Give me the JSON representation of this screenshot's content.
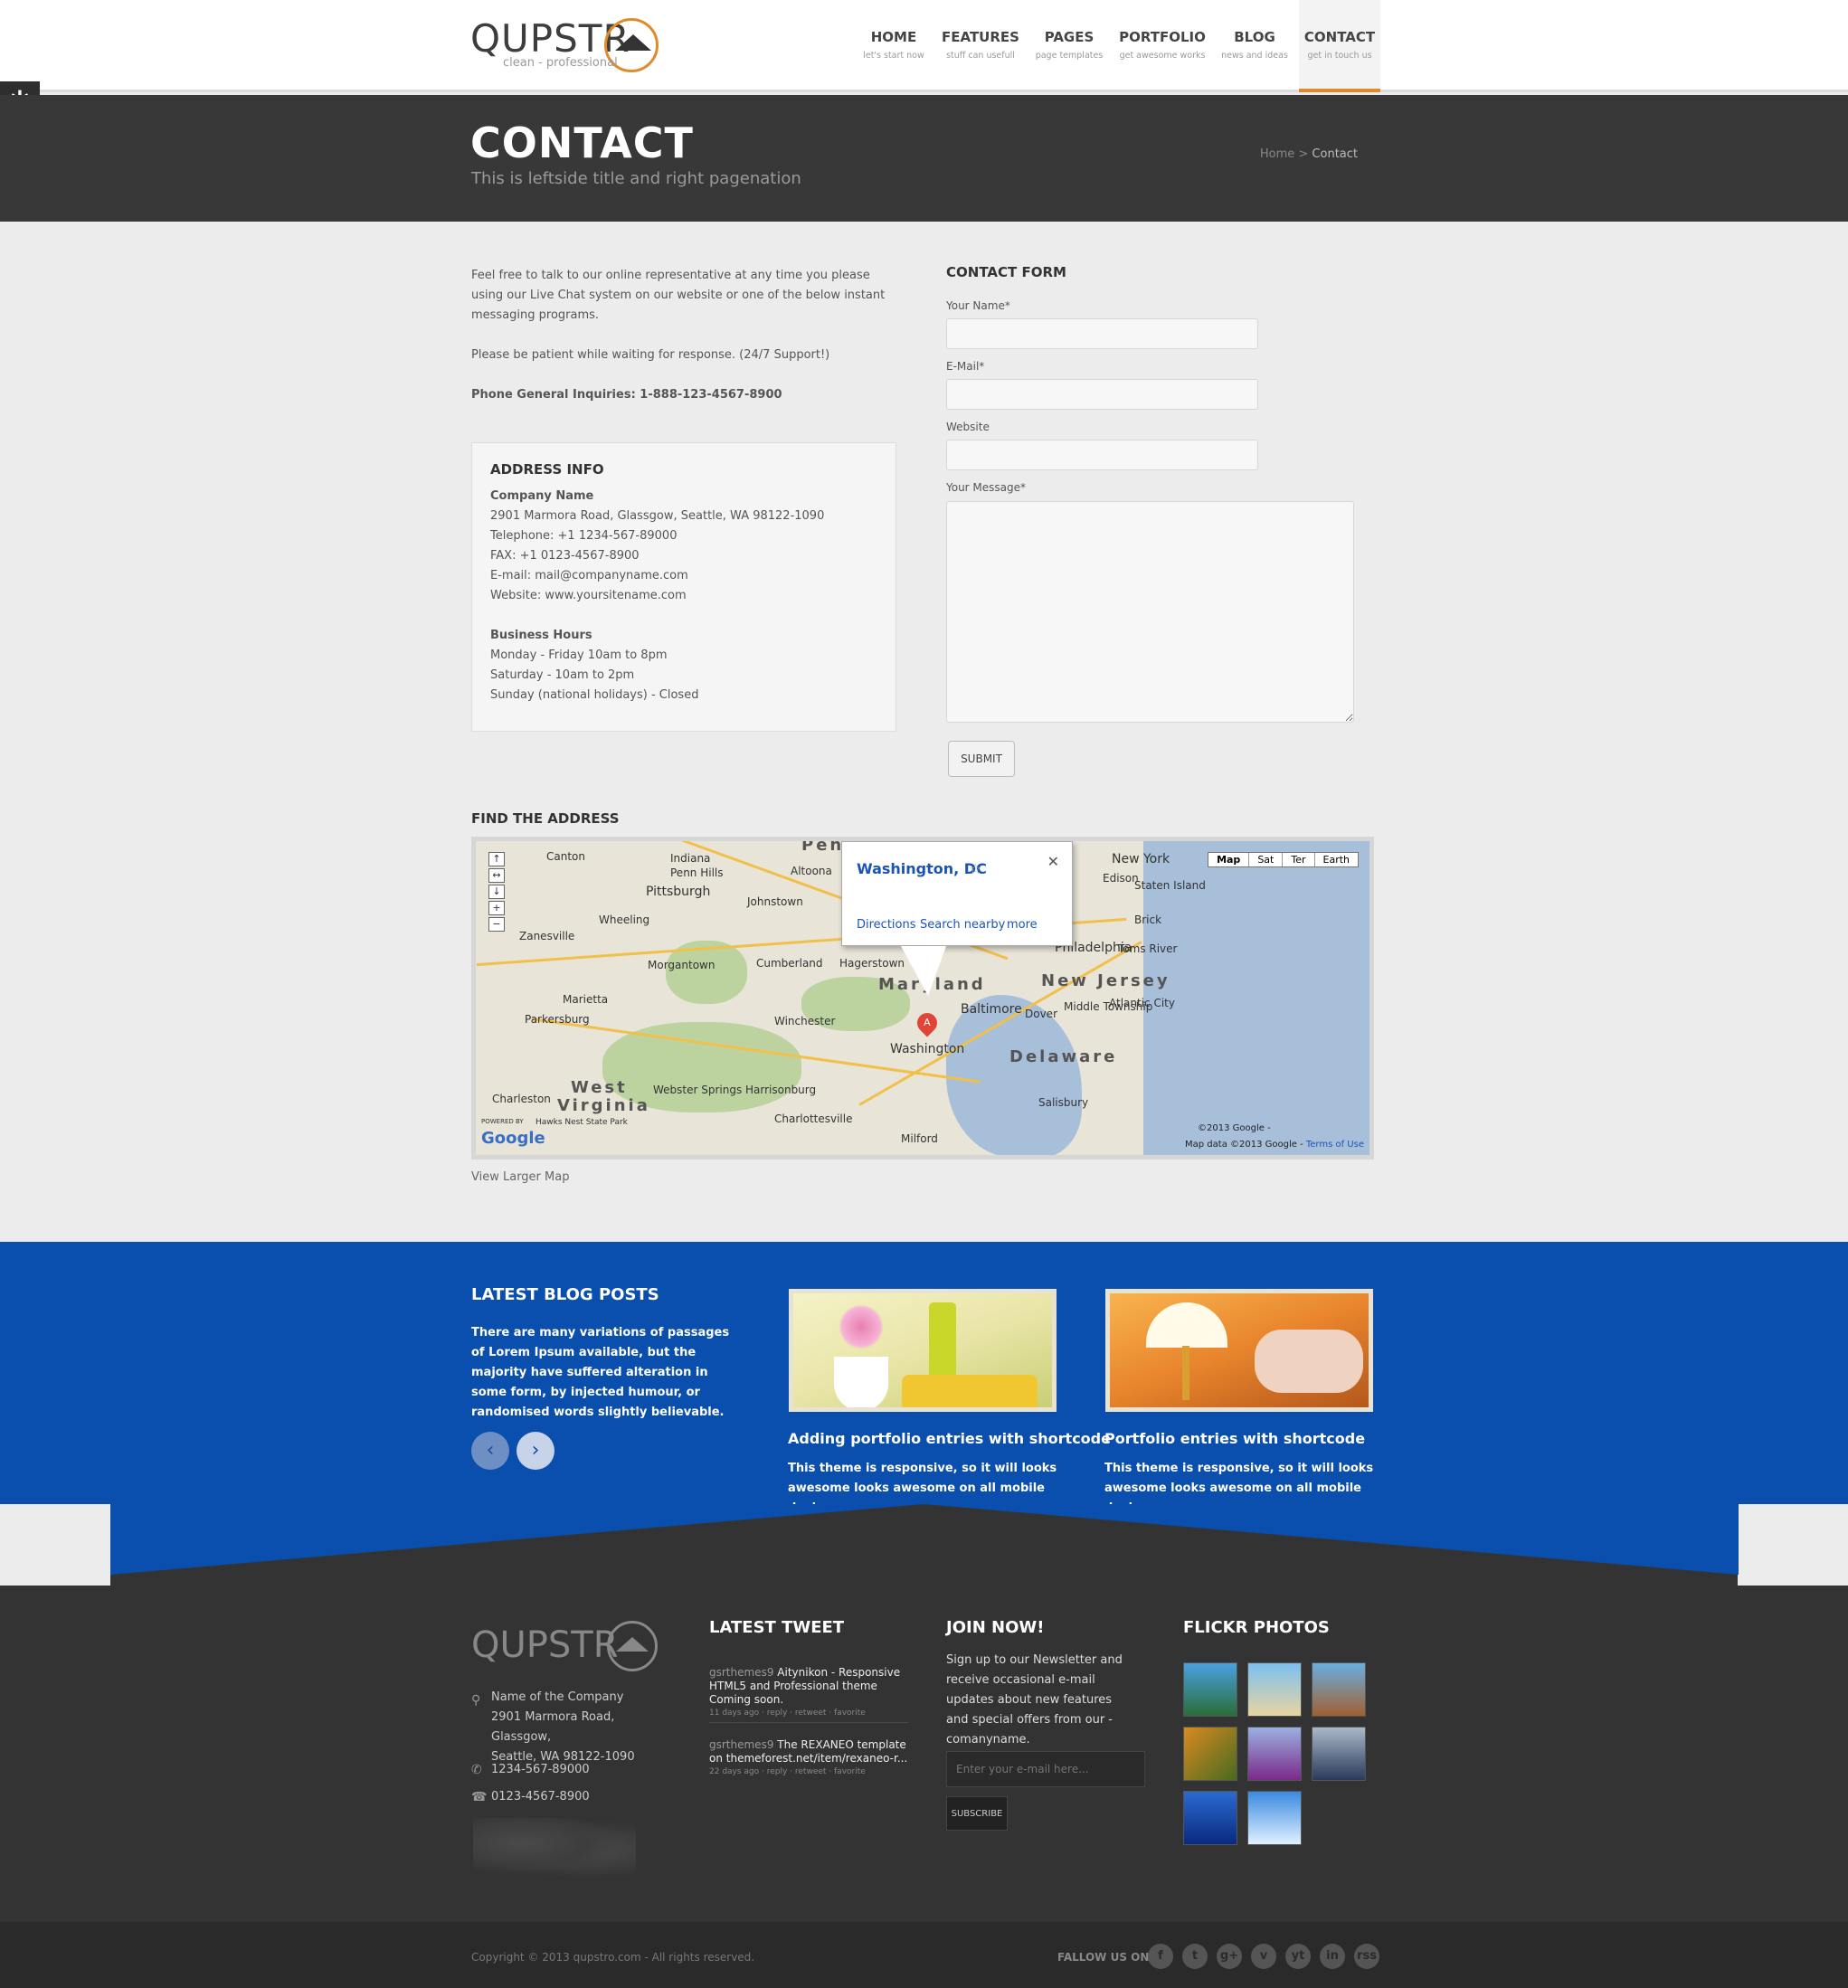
{
  "header": {
    "logo_text": "QUPSTR",
    "logo_tagline": "clean - professional",
    "nav": [
      {
        "label": "HOME",
        "sub": "let's start now"
      },
      {
        "label": "FEATURES",
        "sub": "stuff can usefull"
      },
      {
        "label": "PAGES",
        "sub": "page templates"
      },
      {
        "label": "PORTFOLIO",
        "sub": "get awesome works"
      },
      {
        "label": "BLOG",
        "sub": "news and ideas"
      },
      {
        "label": "CONTACT",
        "sub": "get in touch us"
      }
    ],
    "active_nav": "CONTACT",
    "accent_color": "#e08a2c"
  },
  "titlebar": {
    "title": "CONTACT",
    "subtitle": "This is leftside title and right pagenation",
    "breadcrumb_home": "Home",
    "breadcrumb_sep": " > ",
    "breadcrumb_current": "Contact"
  },
  "intro": {
    "p1": "Feel free to talk to our online representative at any time you please using our Live Chat system on our website or one of the below instant messaging programs.",
    "p2": "Please be patient while waiting for response. (24/7 Support!)",
    "phone": "Phone General Inquiries: 1-888-123-4567-8900"
  },
  "address": {
    "title": "ADDRESS INFO",
    "company": "Company Name",
    "street": "2901 Marmora Road, Glassgow, Seattle, WA 98122-1090",
    "telephone": "Telephone: +1 1234-567-89000",
    "fax": "FAX: +1 0123-4567-8900",
    "email": "E-mail: mail@companyname.com",
    "website": "Website: www.yoursitename.com",
    "hours_title": "Business Hours",
    "hours": [
      "Monday - Friday 10am to 8pm",
      "Saturday - 10am to 2pm",
      "Sunday (national holidays) - Closed"
    ]
  },
  "form": {
    "title": "CONTACT FORM",
    "name_label": "Your Name*",
    "email_label": "E-Mail*",
    "website_label": "Website",
    "message_label": "Your Message*",
    "submit_label": "SUBMIT"
  },
  "map": {
    "title": "FIND THE ADDRESS",
    "types": [
      "Map",
      "Sat",
      "Ter",
      "Earth"
    ],
    "selected_type": "Map",
    "popup_title": "Washington, DC",
    "popup_links": [
      "Directions",
      "Search nearby",
      "more"
    ],
    "pin_label": "A",
    "labels": {
      "pittsburgh": "Pittsburgh",
      "canton": "Canton",
      "wheeling": "Wheeling",
      "zanesville": "Zanesville",
      "morgantown": "Morgantown",
      "cumberland": "Cumberland",
      "hagerstown": "Hagerstown",
      "baltimore": "Baltimore",
      "washington": "Washington",
      "philadelphia": "Philadelphia",
      "new_york": "New York",
      "atlantic_city": "Atlantic City",
      "parkersburg": "Parkersburg",
      "marietta": "Marietta",
      "charleston": "Charleston",
      "harrisonburg": "Harrisonburg",
      "charlottesville": "Charlottesville",
      "winchester": "Winchester",
      "dover": "Dover",
      "salisbury": "Salisbury",
      "indiana": "Indiana",
      "altoona": "Altoona",
      "johnstown": "Johnstown",
      "penn_hills": "Penn Hills",
      "milford": "Milford",
      "webster_springs": "Webster Springs",
      "hawks_nest": "Hawks Nest State Park",
      "toms_river": "Toms River",
      "edison": "Edison",
      "staten_island": "Staten Island",
      "brick": "Brick",
      "middle_township": "Middle Township"
    },
    "states": {
      "pennsylvania": "Pennsylvania",
      "maryland": "Maryland",
      "new_jersey": "New Jersey",
      "delaware": "Delaware",
      "west": "West",
      "virginia": "Virginia"
    },
    "powered_by": "POWERED BY",
    "google_logo": "Google",
    "copyright": "©2013 Google -",
    "map_data": "Map data ©2013 Google - ",
    "terms": "Terms of Use",
    "view_larger": "View Larger Map"
  },
  "blog": {
    "title": "LATEST BLOG POSTS",
    "intro": "There are many variations of passages of Lorem Ipsum available, but the majority have suffered alteration in some form, by injected humour, or randomised words slightly believable.",
    "posts": [
      {
        "title": "Adding portfolio entries with shortcode",
        "text": "This theme is responsive, so it will looks awesome looks awesome on all mobile devices."
      },
      {
        "title": "Portfolio entries with shortcode",
        "text": "This theme is responsive, so it will looks awesome looks awesome on all mobile devices."
      }
    ],
    "band_color": "#0a4fad"
  },
  "footer": {
    "logo_text": "QUPSTR",
    "address_lines": [
      "Name of the Company",
      "2901 Marmora Road, Glassgow,",
      "Seattle, WA 98122-1090"
    ],
    "phone": "1234-567-89000",
    "fax": "0123-4567-8900",
    "tweet_title": "LATEST TWEET",
    "tweets": [
      {
        "handle": "gsrthemes9",
        "text": "Aitynikon - Responsive HTML5 and Professional theme Coming soon.",
        "meta": "11 days ago · reply · retweet · favorite"
      },
      {
        "handle": "gsrthemes9",
        "text": "The REXANEO template on themeforest.net/item/rexaneo-r...",
        "meta": "22 days ago · reply · retweet · favorite"
      }
    ],
    "join_title": "JOIN NOW!",
    "join_text": "Sign up to our Newsletter and receive occasional e-mail updates about new features and special offers from our - comanyname.",
    "join_placeholder": "Enter your e-mail here...",
    "subscribe_label": "SUBSCRIBE",
    "flickr_title": "FLICKR PHOTOS",
    "copyright": "Copyright © 2013 qupstro.com - All rights reserved.",
    "follow_label": "FALLOW US ON:",
    "socials": [
      "f",
      "t",
      "g+",
      "v",
      "yt",
      "in",
      "rss"
    ]
  }
}
